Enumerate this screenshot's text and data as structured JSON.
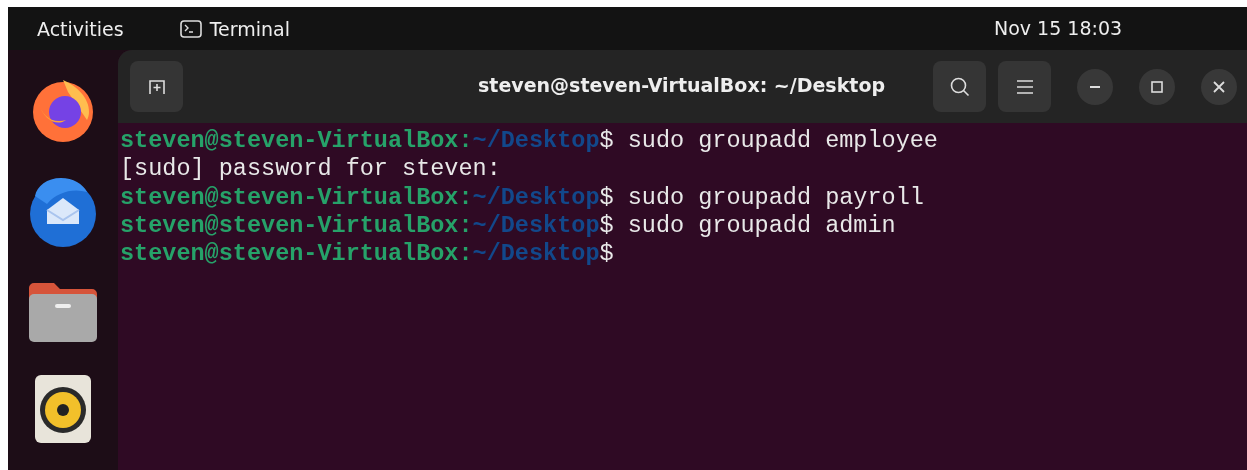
{
  "top_bar": {
    "activities": "Activities",
    "app_name": "Terminal",
    "clock": "Nov 15  18:03"
  },
  "dock": {
    "items": [
      {
        "kind": "browser"
      },
      {
        "kind": "mail"
      },
      {
        "kind": "files"
      },
      {
        "kind": "music"
      }
    ]
  },
  "window": {
    "title": "steven@steven-VirtualBox: ~/Desktop"
  },
  "terminal": {
    "lines": [
      {
        "kind": "prompt",
        "user": "steven@steven-VirtualBox:",
        "path": "~/Desktop",
        "symbol": "$",
        "command": "sudo groupadd employee"
      },
      {
        "kind": "output",
        "text": "[sudo] password for steven:"
      },
      {
        "kind": "prompt",
        "user": "steven@steven-VirtualBox:",
        "path": "~/Desktop",
        "symbol": "$",
        "command": "sudo groupadd payroll"
      },
      {
        "kind": "prompt",
        "user": "steven@steven-VirtualBox:",
        "path": "~/Desktop",
        "symbol": "$",
        "command": "sudo groupadd admin"
      },
      {
        "kind": "prompt",
        "user": "steven@steven-VirtualBox:",
        "path": "~/Desktop",
        "symbol": "$"
      }
    ]
  }
}
